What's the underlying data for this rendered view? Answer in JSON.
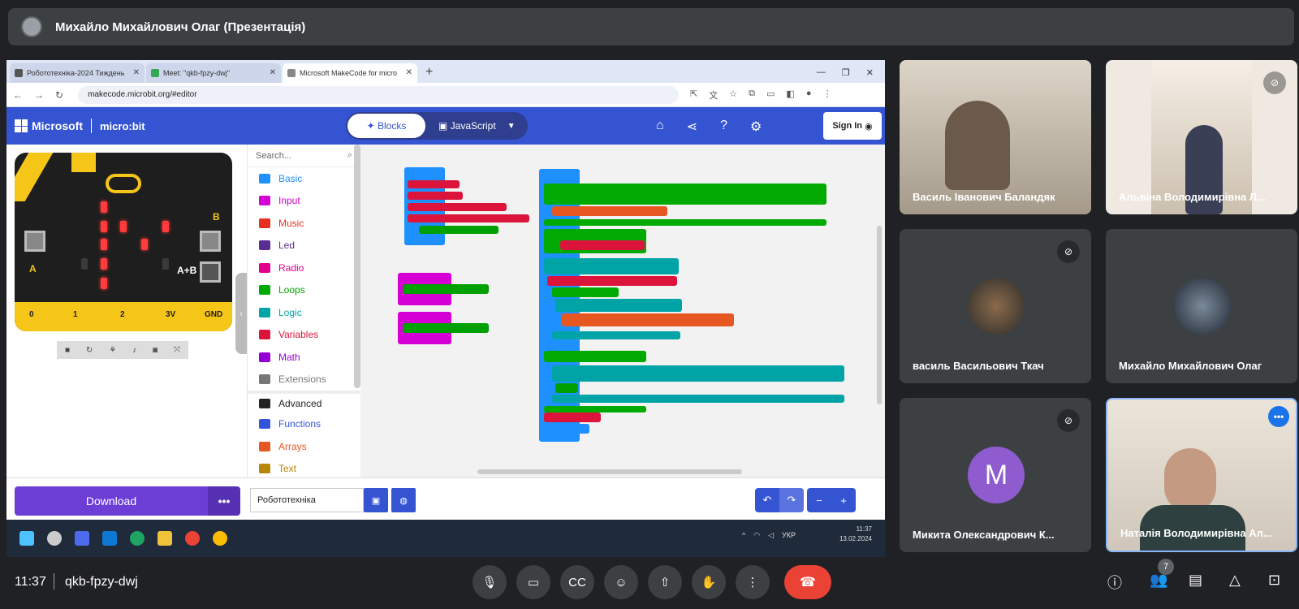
{
  "meeting": {
    "presenter_title": "Михайло Михайлович Олаг (Презентація)",
    "time": "11:37",
    "code": "qkb-fpzy-dwj",
    "participants_count": "7"
  },
  "browser": {
    "tabs": [
      {
        "label": "Робототехніка-2024 Тиждень"
      },
      {
        "label": "Meet: \"qkb-fpzy-dwj\""
      },
      {
        "label": "Microsoft MakeCode for micro"
      }
    ],
    "url": "makecode.microbit.org/#editor"
  },
  "makecode": {
    "brand": "Microsoft",
    "product": "micro:bit",
    "mode_blocks": "Blocks",
    "mode_js": "JavaScript",
    "signin": "Sign In",
    "search_placeholder": "Search...",
    "categories": [
      {
        "label": "Basic",
        "color": "#1e90ff"
      },
      {
        "label": "Input",
        "color": "#d400d4"
      },
      {
        "label": "Music",
        "color": "#e63022"
      },
      {
        "label": "Led",
        "color": "#5c2d91"
      },
      {
        "label": "Radio",
        "color": "#e3008c"
      },
      {
        "label": "Loops",
        "color": "#00aa00"
      },
      {
        "label": "Logic",
        "color": "#00a4a6"
      },
      {
        "label": "Variables",
        "color": "#dc143c"
      },
      {
        "label": "Math",
        "color": "#9400d3"
      },
      {
        "label": "Extensions",
        "color": "#777777"
      },
      {
        "label": "Advanced",
        "color": "#222222"
      },
      {
        "label": "Functions",
        "color": "#3455db"
      },
      {
        "label": "Arrays",
        "color": "#e65722"
      },
      {
        "label": "Text",
        "color": "#b8860b"
      }
    ],
    "board_labels": {
      "a": "A",
      "b": "B",
      "ab": "A+B"
    },
    "pins": [
      "0",
      "1",
      "2",
      "3V",
      "GND"
    ],
    "download": "Download",
    "download_more": "•••",
    "project_name": "Робототехніка"
  },
  "taskbar": {
    "lang": "УКР",
    "time": "11:37",
    "date": "13.02.2024"
  },
  "participants": [
    {
      "name": "Василь Іванович Баландяк"
    },
    {
      "name": "Альвіна Володимирівна Л..."
    },
    {
      "name": "василь Васильович Ткач"
    },
    {
      "name": "Михайло Михайлович Олаг"
    },
    {
      "name": "Микита Олександрович К...",
      "initial": "M"
    },
    {
      "name": "Наталія Володимирівна Ал..."
    }
  ],
  "colors": {
    "makecode_blue": "#3454d1",
    "download_purple": "#6d3ed6",
    "hangup_red": "#ea4335",
    "meet_bg": "#202124"
  }
}
